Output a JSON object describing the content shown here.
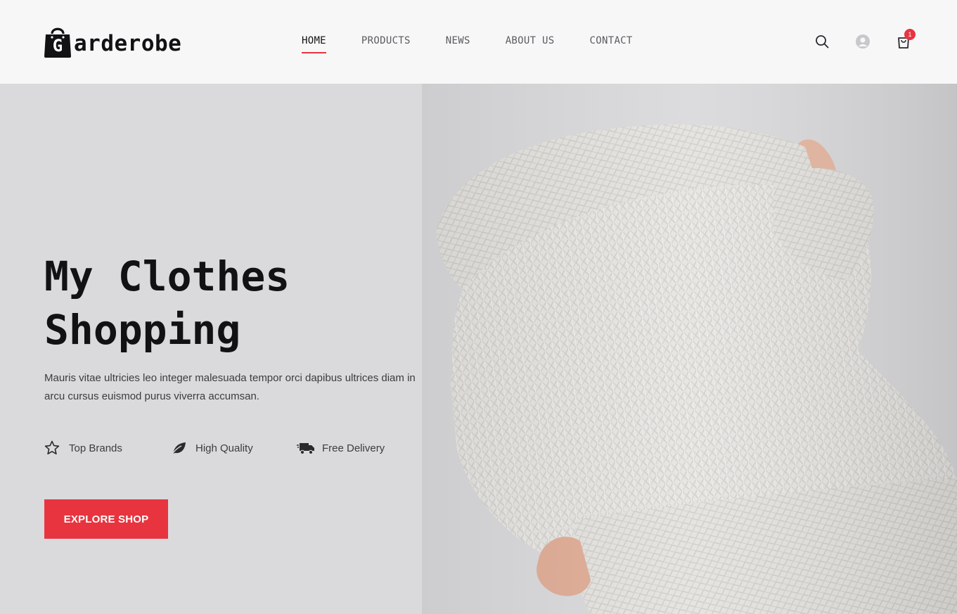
{
  "header": {
    "logo_letter": "G",
    "logo_text": "arderobe",
    "nav": [
      {
        "label": "HOME",
        "active": true
      },
      {
        "label": "PRODUCTS",
        "active": false
      },
      {
        "label": "NEWS",
        "active": false
      },
      {
        "label": "ABOUT US",
        "active": false
      },
      {
        "label": "CONTACT",
        "active": false
      }
    ],
    "icons": [
      "search-icon",
      "user-avatar-icon",
      "shopping-bag-icon"
    ],
    "cart_count": "1"
  },
  "hero": {
    "title_line1": "My Clothes",
    "title_line2": "Shopping",
    "description": "Mauris vitae ultricies leo integer malesuada tempor orci dapibus ultrices diam in arcu cursus euismod purus viverra accumsan.",
    "features": [
      {
        "icon": "star-icon",
        "label": "Top Brands"
      },
      {
        "icon": "leaf-icon",
        "label": "High Quality"
      },
      {
        "icon": "truck-icon",
        "label": "Free Delivery"
      }
    ],
    "cta_label": "EXPLORE SHOP",
    "image": "person-in-white-knit-sweater"
  },
  "colors": {
    "accent": "#e8343f",
    "header_bg": "#f7f7f8",
    "hero_bg": "#dadadc",
    "text_dark": "#121214"
  }
}
